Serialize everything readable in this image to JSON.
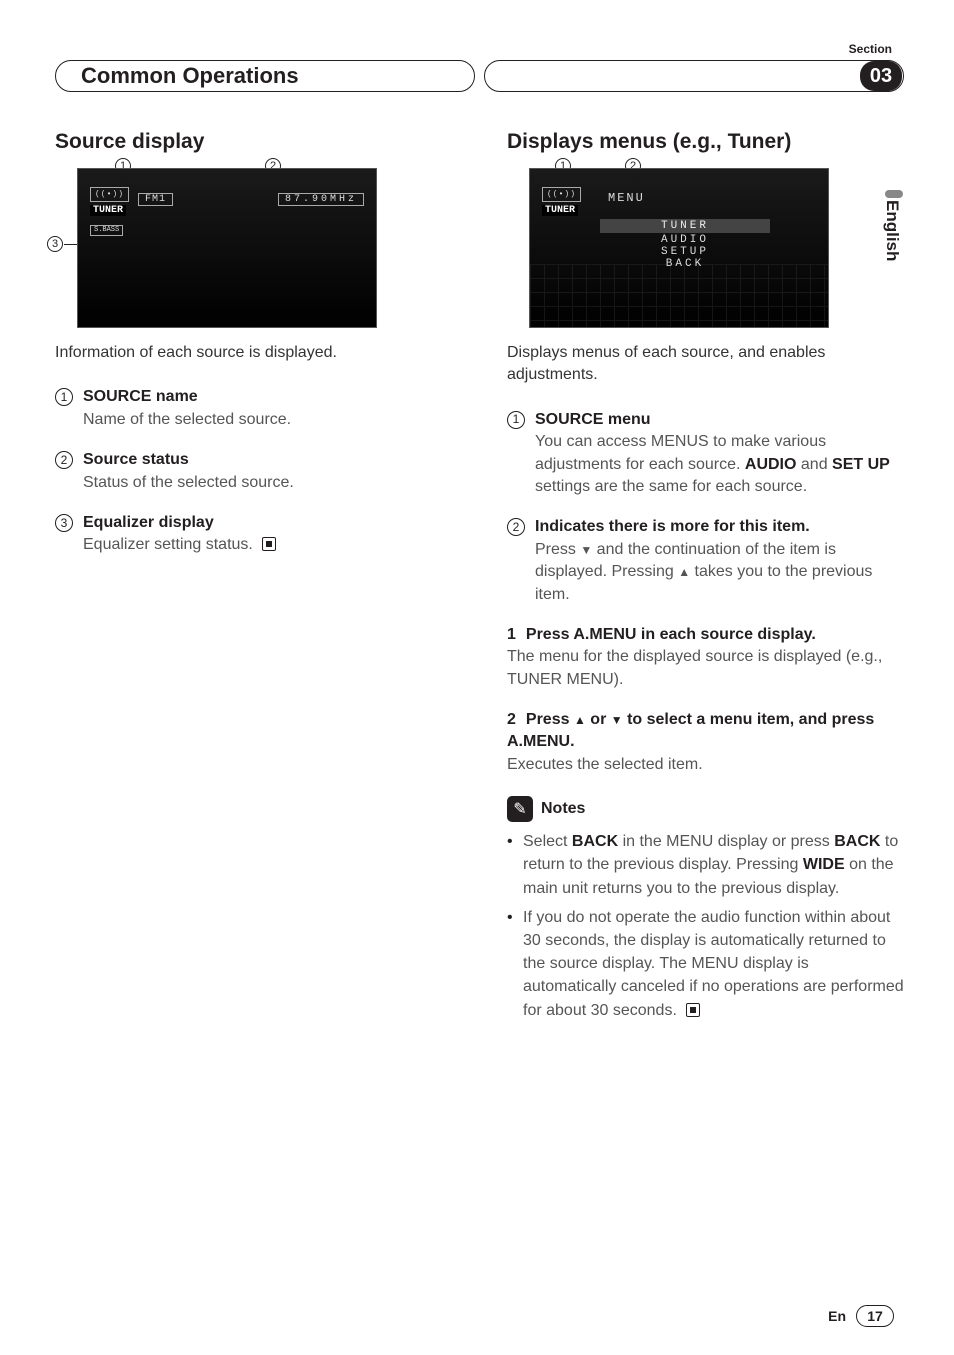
{
  "section_label": "Section",
  "chapter_title": "Common Operations",
  "chapter_number": "03",
  "language_tab": "English",
  "left": {
    "heading": "Source display",
    "lcd": {
      "band": "FM1",
      "freq": "87.90MHz",
      "tuner": "TUNER",
      "sbass": "S.BASS"
    },
    "caption": "Information of each source is displayed.",
    "items": [
      {
        "num": "1",
        "title": "SOURCE name",
        "desc": "Name of the selected source."
      },
      {
        "num": "2",
        "title": "Source status",
        "desc": "Status of the selected source."
      },
      {
        "num": "3",
        "title": "Equalizer display",
        "desc": "Equalizer setting status."
      }
    ]
  },
  "right": {
    "heading": "Displays menus (e.g., Tuner)",
    "lcd": {
      "tuner": "TUNER",
      "menu": "MENU",
      "items": [
        "TUNER",
        "AUDIO",
        "SETUP",
        "BACK"
      ]
    },
    "caption": "Displays menus of each source, and enables adjustments.",
    "items": [
      {
        "num": "1",
        "title": "SOURCE menu",
        "desc_pre": "You can access MENUS to make various adjustments for each source. ",
        "bold1": "AUDIO",
        "mid": " and ",
        "bold2": "SET UP",
        "desc_post": " settings are the same for each source."
      },
      {
        "num": "2",
        "title": "Indicates there is more for this item.",
        "desc_a": "Press ",
        "arrow_down": "▼",
        "desc_b": " and the continuation of the item is displayed. Pressing ",
        "arrow_up": "▲",
        "desc_c": " takes you to the previous item."
      }
    ],
    "steps": [
      {
        "num": "1",
        "title_a": "Press ",
        "menu_key": "A.MENU",
        "title_b": " in each source display.",
        "desc": "The menu for the displayed source is displayed (e.g., TUNER MENU)."
      },
      {
        "num": "2",
        "title_a": "Press ",
        "arrow_up": "▲",
        "or": " or ",
        "arrow_down": "▼",
        "title_b": " to select a menu item, and press ",
        "menu_key": "A.MENU",
        "title_c": ".",
        "desc": "Executes the selected item."
      }
    ],
    "notes_label": "Notes",
    "notes": [
      {
        "pre": "Select ",
        "b1": "BACK",
        "mid1": " in the MENU display or press ",
        "b2": "BACK",
        "mid2": " to return to the previous display. Pressing ",
        "b3": "WIDE",
        "post": " on the main unit returns you to the previous display."
      },
      {
        "text": "If you do not operate the audio function within about 30 seconds, the display is automatically returned to the source display. The MENU display is automatically canceled if no operations are performed for about 30 seconds."
      }
    ]
  },
  "footer": {
    "lang": "En",
    "page": "17"
  }
}
